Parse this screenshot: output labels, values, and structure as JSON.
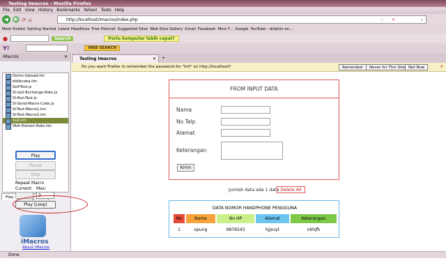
{
  "window": {
    "title": "Testing Imacros - Mozilla Firefox"
  },
  "menu": [
    "File",
    "Edit",
    "View",
    "History",
    "Bookmarks",
    "Yahoo!",
    "Tools",
    "Help"
  ],
  "nav": {
    "url": "http://localhost/imacros/index.php"
  },
  "bookmarks": [
    "Most Visited",
    "Getting Started",
    "Latest Headlines",
    "Free Hotmail",
    "Suggested Sites",
    "Web Slice Gallery",
    "Gmail",
    "Facebook",
    "Mivo.T...",
    "Google",
    "YouTube - dolphin an..."
  ],
  "toolbar": {
    "search_label": "Search",
    "websearch_label": "WEB SEARCH",
    "promo": "Perlu komputer lebih cepat?"
  },
  "sidebar": {
    "title": "iMacros",
    "files": [
      "Demo-Upload.iim",
      "didikcoba.iim",
      "Self-Test.js",
      "SI-Get-Exchange-Rate.js",
      "SI-Run-Test.js",
      "SI-Send-Macro-Code.js",
      "SI-Test-Macro1.iim",
      "SI-Test-Macro2.iim",
      "test.iim",
      "Wsh-Extract-Rate.iim"
    ],
    "tabs": [
      "Play",
      "Rec",
      "Edit"
    ],
    "play_label": "Play",
    "pause_label": "Pause",
    "stop_label": "Stop",
    "repeat_label": "Repeat Macro",
    "current_label": "Current:",
    "max_label": "Max:",
    "max_value": "3",
    "loop_label": "Play (Loop)",
    "brand": "iMacros",
    "about": "About iMacros"
  },
  "tab": {
    "title": "Testing Imacros"
  },
  "notification": {
    "text": "Do you want Firefox to remember the password for \"Intl\" on http://localhost?",
    "remember": "Remember",
    "never": "Never for This Site",
    "notnow": "Not Now"
  },
  "form": {
    "title": "FROM INPUT DATA",
    "nama": "Nama",
    "notelp": "No Telp",
    "alamat": "Alamat",
    "keterangan": "Keterangan",
    "submit": "Kirim"
  },
  "summary": {
    "count_text": "Jumlah data ada 1 data",
    "delete_label": "Delete All"
  },
  "table": {
    "title": "DATA NOMOR HANDPHONE PENGGUNA",
    "headers": [
      "No",
      "Nama",
      "No HP",
      "Alamat",
      "Keterangan"
    ],
    "header_colors": [
      "#e84a3a",
      "#f7a23a",
      "#c9f08a",
      "#6ec6f0",
      "#7ec94a"
    ],
    "rows": [
      [
        "1",
        "opung",
        "9876543",
        "hjjsuyt",
        "nbhjfk"
      ]
    ]
  },
  "status": {
    "text": "Done"
  }
}
